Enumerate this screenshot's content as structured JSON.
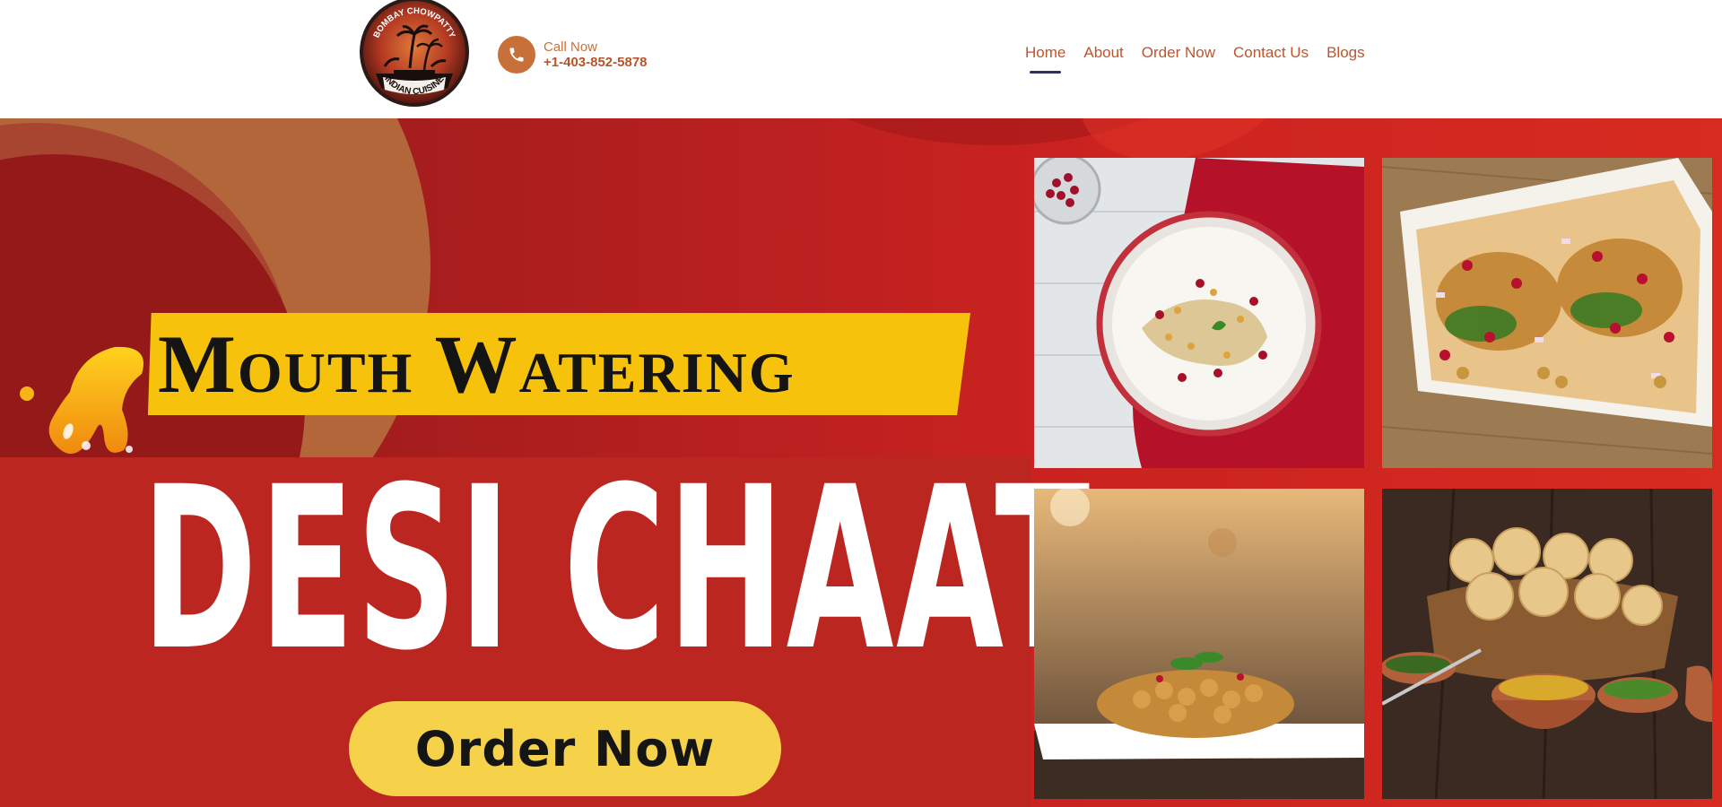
{
  "header": {
    "logo": {
      "top_text": "BOMBAY CHOWPATTY",
      "bottom_text": "INDIAN CUISINE"
    },
    "call": {
      "label": "Call Now",
      "phone": "+1-403-852-5878",
      "icon": "phone-icon"
    },
    "nav": [
      {
        "label": "Home",
        "active": true
      },
      {
        "label": "About",
        "active": false
      },
      {
        "label": "Order Now",
        "active": false
      },
      {
        "label": "Contact Us",
        "active": false
      },
      {
        "label": "Blogs",
        "active": false
      }
    ]
  },
  "hero": {
    "tagline": "Mouth Watering",
    "headline": "DESI CHAAT",
    "cta_label": "Order Now",
    "tiles": [
      {
        "subject": "dahi-chaat-bowl-photo"
      },
      {
        "subject": "aloo-tikki-chaat-platter-photo"
      },
      {
        "subject": "chana-chaat-plate-photo"
      },
      {
        "subject": "pani-puri-basket-photo"
      }
    ]
  },
  "colors": {
    "accent": "#c8703a",
    "nav_text": "#c0542c",
    "active_underline": "#2e3160",
    "hero_red": "#c92220",
    "banner_yellow": "#f6c20b",
    "button_yellow": "#f5d24a"
  }
}
